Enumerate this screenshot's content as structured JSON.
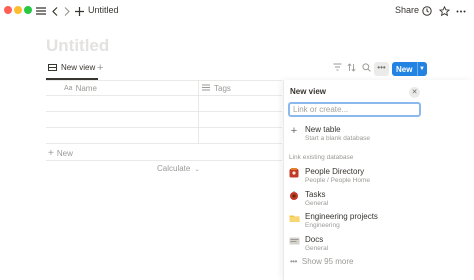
{
  "window": {
    "title": "Untitled"
  },
  "toolbar": {
    "share_label": "Share"
  },
  "page": {
    "title": "Untitled"
  },
  "viewbar": {
    "view_tab_label": "New view",
    "new_button_label": "New"
  },
  "table": {
    "columns": [
      {
        "label": "Name",
        "icon": "text-property-icon"
      },
      {
        "label": "Tags",
        "icon": "list-property-icon"
      }
    ],
    "new_row_label": "New",
    "calculate_label": "Calculate"
  },
  "panel": {
    "title": "New view",
    "search_placeholder": "Link or create...",
    "new_table": {
      "label": "New table",
      "subtitle": "Start a blank database"
    },
    "section_label": "Link existing database",
    "databases": [
      {
        "label": "People Directory",
        "subtitle": "People / People Home",
        "icon": "people-directory-icon"
      },
      {
        "label": "Tasks",
        "subtitle": "General",
        "icon": "tasks-icon"
      },
      {
        "label": "Engineering projects",
        "subtitle": "Engineering",
        "icon": "folder-icon"
      },
      {
        "label": "Docs",
        "subtitle": "General",
        "icon": "docs-icon"
      }
    ],
    "show_more_label": "Show 95 more"
  },
  "colors": {
    "accent": "#2383e2",
    "title_placeholder": "#e3e2e0",
    "muted_text": "#9b9a97"
  }
}
